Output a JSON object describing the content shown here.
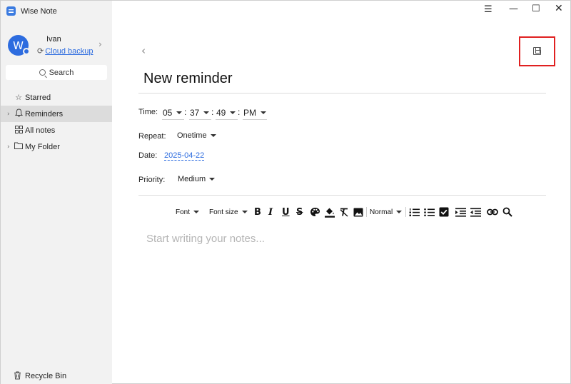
{
  "app": {
    "title": "Wise Note"
  },
  "window_controls": {
    "menu": "☰",
    "minimize": "—",
    "maximize": "☐",
    "close": "✕"
  },
  "profile": {
    "avatar_letter": "W",
    "name": "Ivan",
    "cloud_backup": "Cloud backup"
  },
  "search": {
    "label": "Search"
  },
  "nav": {
    "items": [
      {
        "label": "Starred",
        "icon": "star-icon",
        "glyph": "☆",
        "caret": ""
      },
      {
        "label": "Reminders",
        "icon": "bell-icon",
        "glyph": "🔔",
        "caret": "›"
      },
      {
        "label": "All notes",
        "icon": "grid-icon",
        "glyph": "▦",
        "caret": ""
      },
      {
        "label": "My Folder",
        "icon": "folder-icon",
        "glyph": "▭",
        "caret": "›"
      }
    ],
    "recycle_bin": "Recycle Bin"
  },
  "editor_header": {
    "title": "New reminder"
  },
  "reminder": {
    "time_label": "Time:",
    "hour": "05",
    "minute": "37",
    "second": "49",
    "ampm": "PM",
    "repeat_label": "Repeat:",
    "repeat_value": "Onetime",
    "date_label": "Date:",
    "date_value": "2025-04-22",
    "priority_label": "Priority:",
    "priority_value": "Medium"
  },
  "toolbar": {
    "font": "Font",
    "font_size": "Font size",
    "bold": "B",
    "italic": "I",
    "underline": "U",
    "strike": "S",
    "heading": "Normal"
  },
  "editor": {
    "placeholder": "Start writing your notes..."
  },
  "colors": {
    "accent": "#2d6cdf",
    "highlight_frame": "#e02020",
    "sidebar_bg": "#f2f2f2"
  }
}
